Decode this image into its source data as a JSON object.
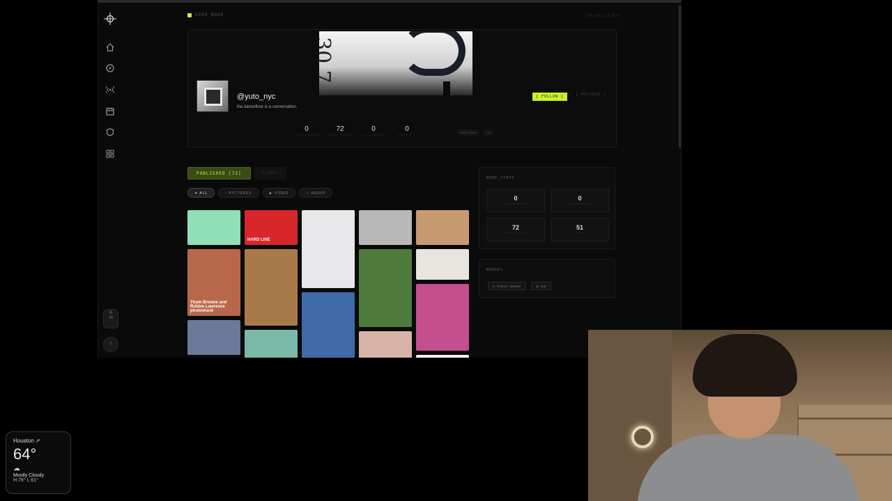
{
  "app": {
    "status_label": "USER_NODE",
    "clock": "05:42:18 EST"
  },
  "sidebar": {
    "items": [
      {
        "icon": "home-icon"
      },
      {
        "icon": "compass-icon"
      },
      {
        "icon": "broadcast-icon"
      },
      {
        "icon": "calendar-icon"
      },
      {
        "icon": "shield-icon"
      },
      {
        "icon": "grid-icon"
      }
    ],
    "pill_label": "70",
    "bottom_label": "!"
  },
  "profile": {
    "username": "@yuto_nyc",
    "bio": "the dancefloor is a conversation.",
    "follow_label": "[ FOLLOW ]",
    "message_label": "[ MESSAGE ]",
    "stats": [
      {
        "value": "0",
        "label": "FOLLOWERS"
      },
      {
        "value": "72",
        "label": "CREATIONS"
      },
      {
        "value": "0",
        "label": "FOLLOWING"
      },
      {
        "value": "0",
        "label": "CREDITS"
      }
    ],
    "mini_tags": [
      "FIRST DROP",
      "OG"
    ]
  },
  "tabs": [
    {
      "label": "PUBLISHED [72]",
      "active": true
    },
    {
      "label": "CLANS",
      "active": false
    }
  ],
  "filters": [
    {
      "label": "✦ ALL",
      "active": true
    },
    {
      "label": "▫ PICTURES",
      "active": false
    },
    {
      "label": "▶ VIDEO",
      "active": false
    },
    {
      "label": "♫ AUDIO",
      "active": false
    }
  ],
  "grid": {
    "tiles": [
      {
        "color": "#8fe0b8",
        "caption": ""
      },
      {
        "color": "#d8262a",
        "caption": "HARD LINE"
      },
      {
        "color": "#e8e8ea",
        "caption": ""
      },
      {
        "color": "#b8b8b8",
        "caption": ""
      },
      {
        "color": "#c89a72",
        "caption": ""
      },
      {
        "color": "#b8684a",
        "caption": "Thom Browne and Robbie Lawrence photoshoot"
      },
      {
        "color": "#a87a4a",
        "caption": ""
      },
      {
        "color": "#3e6aa8",
        "caption": ""
      },
      {
        "color": "#4e7a3c",
        "caption": ""
      },
      {
        "color": "#e8e4e0",
        "caption": ""
      },
      {
        "color": "#c44e8e",
        "caption": ""
      },
      {
        "color": "#6a7a98",
        "caption": ""
      },
      {
        "color": "#7ab8a8",
        "caption": ""
      },
      {
        "color": "#d8b4a8",
        "caption": ""
      },
      {
        "color": "#f2f2f2",
        "caption": ""
      }
    ]
  },
  "node_stats": {
    "title": "NODE_STATS",
    "items": [
      {
        "value": "0",
        "label": "FOLLOWERS"
      },
      {
        "value": "0",
        "label": "FOLLOWING"
      },
      {
        "value": "72",
        "label": "CREATIONS"
      },
      {
        "value": "51",
        "label": "VIEWS"
      }
    ]
  },
  "badges": {
    "title": "BADGES",
    "items": [
      "⬡ FIRST DROP",
      "◎ OG"
    ]
  },
  "weather": {
    "city": "Houston ➚",
    "temp": "64°",
    "icon": "cloud-icon",
    "condition": "Mostly Cloudy",
    "high_low": "H:78° L:61°"
  }
}
